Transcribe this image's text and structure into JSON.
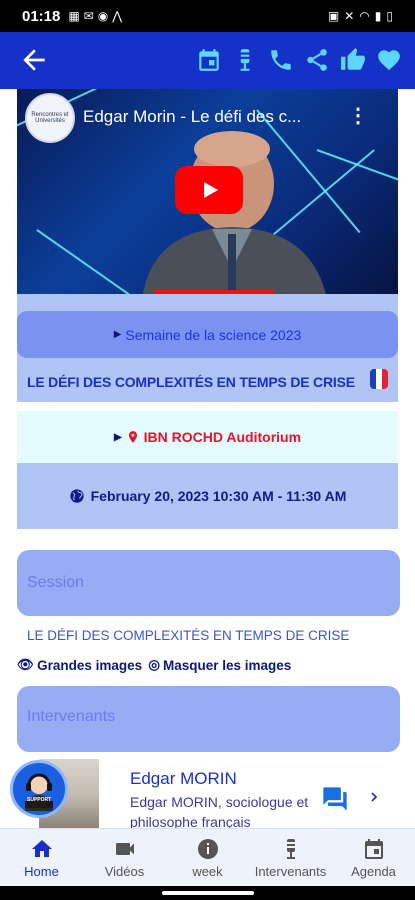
{
  "status_bar": {
    "time": "01:18"
  },
  "app_bar": {
    "icons": [
      "back-arrow-icon",
      "calendar-icon",
      "microphone-icon",
      "phone-icon",
      "share-icon",
      "thumbs-up-icon",
      "heart-icon"
    ]
  },
  "video": {
    "title": "Edgar Morin - Le défi des c...",
    "channel_logo_text": "Rencontres et Universités"
  },
  "event": {
    "seminar": "Semaine de la science 2023",
    "title": "LE DÉFI DES COMPLEXITÉS EN TEMPS DE CRISE",
    "location": "IBN ROCHD Auditorium",
    "datetime": "February 20, 2023 10:30 AM - 11:30 AM"
  },
  "session": {
    "heading": "Session",
    "text": "LE DÉFI DES COMPLEXITÉS EN TEMPS DE CRISE",
    "large_images_label": "Grandes images",
    "hide_images_label": "Masquer les images"
  },
  "speakers": {
    "heading": "Intervenants",
    "items": [
      {
        "name": "Edgar MORIN",
        "description": "Edgar MORIN, sociologue et philosophe français"
      }
    ]
  },
  "support_badge": "SUPPORT",
  "bottom_nav": {
    "items": [
      {
        "label": "Home",
        "icon": "home-icon"
      },
      {
        "label": "Vidéos",
        "icon": "video-camera-icon"
      },
      {
        "label": "week",
        "icon": "info-icon"
      },
      {
        "label": "Intervenants",
        "icon": "microphone-icon"
      },
      {
        "label": "Agenda",
        "icon": "calendar-icon"
      }
    ]
  },
  "colors": {
    "app_bar": "#1432c8",
    "accent": "#1a2fc8",
    "location_red": "#e8132a",
    "panel_blue": "#b0c4f5"
  }
}
